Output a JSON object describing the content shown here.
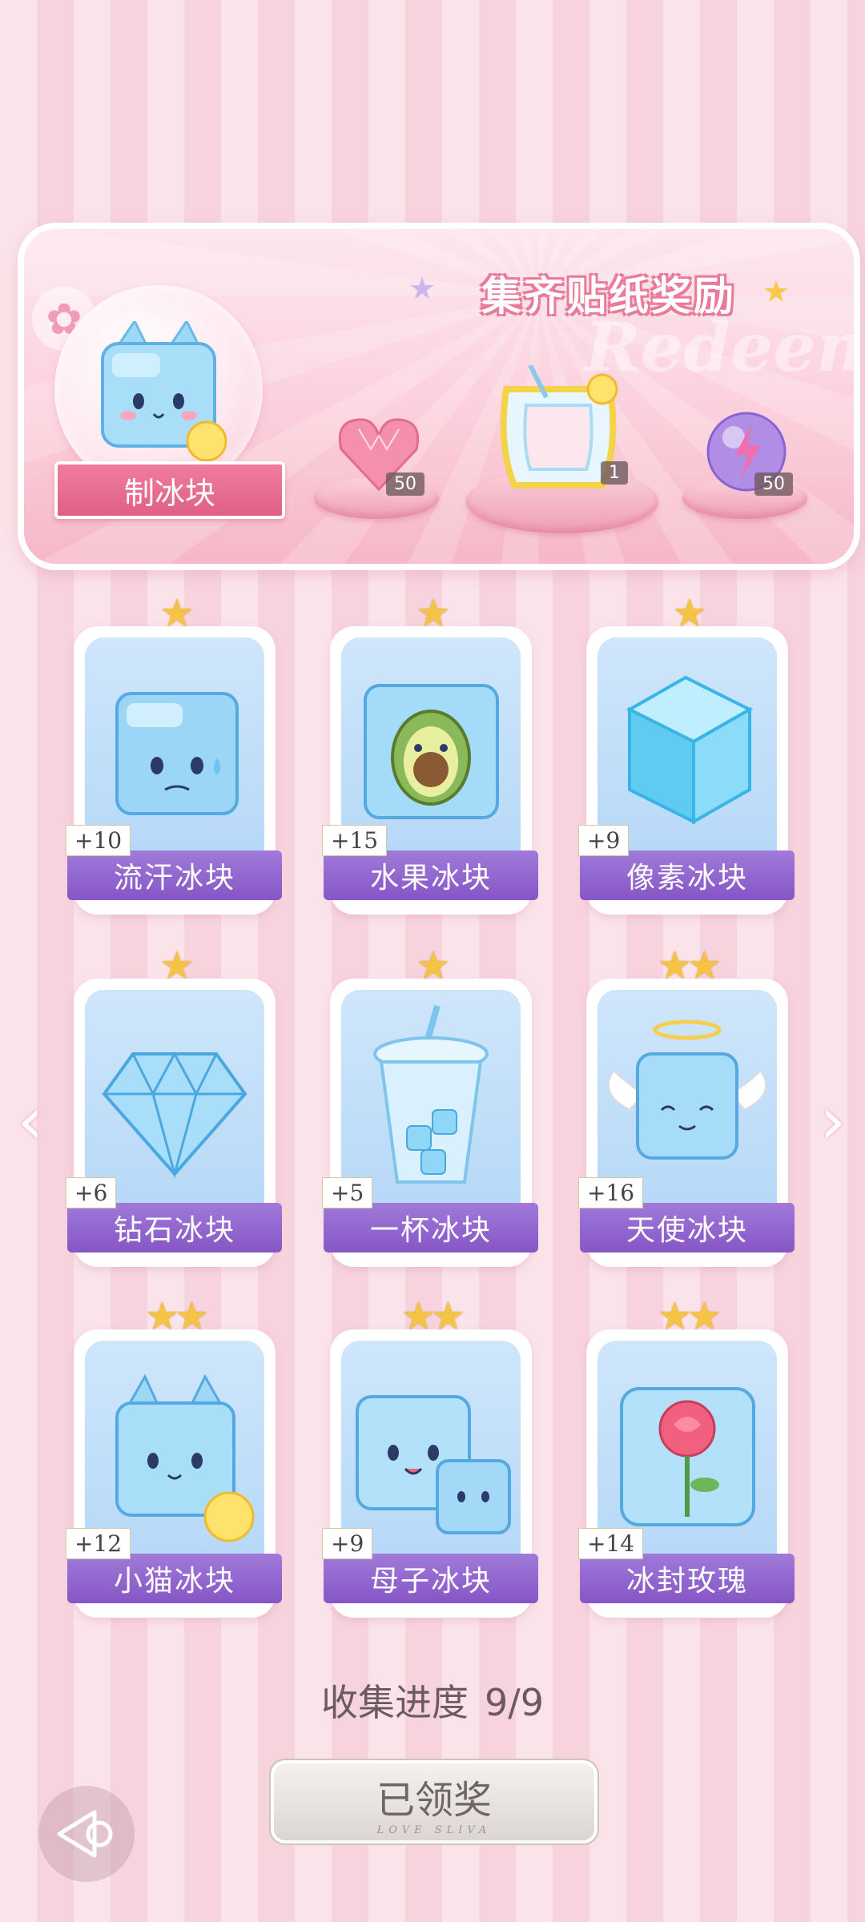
{
  "banner": {
    "title": "集齐贴纸奖励",
    "watermark": "Redeem",
    "feature_label": "制冰块",
    "rewards": [
      {
        "icon": "heart-gem-icon",
        "count": "50"
      },
      {
        "icon": "lemon-drink-frame-icon",
        "count": "1"
      },
      {
        "icon": "lightning-orb-icon",
        "count": "50"
      }
    ]
  },
  "cards": [
    {
      "name": "流汗冰块",
      "bonus": "+10",
      "stars": "★",
      "icon": "sweating-ice-cube-icon"
    },
    {
      "name": "水果冰块",
      "bonus": "+15",
      "stars": "★",
      "icon": "avocado-ice-cube-icon"
    },
    {
      "name": "像素冰块",
      "bonus": "+9",
      "stars": "★",
      "icon": "pixel-ice-cube-icon"
    },
    {
      "name": "钻石冰块",
      "bonus": "+6",
      "stars": "★",
      "icon": "diamond-ice-icon"
    },
    {
      "name": "一杯冰块",
      "bonus": "+5",
      "stars": "★",
      "icon": "cup-of-ice-icon"
    },
    {
      "name": "天使冰块",
      "bonus": "+16",
      "stars": "★★",
      "icon": "angel-ice-cube-icon"
    },
    {
      "name": "小猫冰块",
      "bonus": "+12",
      "stars": "★★",
      "icon": "cat-ice-cube-icon"
    },
    {
      "name": "母子冰块",
      "bonus": "+9",
      "stars": "★★",
      "icon": "mother-child-ice-icon"
    },
    {
      "name": "冰封玫瑰",
      "bonus": "+14",
      "stars": "★★",
      "icon": "frozen-rose-icon"
    }
  ],
  "progress": {
    "label": "收集进度",
    "value": "9/9"
  },
  "claim_button": {
    "label": "已领奖",
    "subtitle": "LOVE SLIVA"
  },
  "colors": {
    "accent": "#8656c6",
    "banner_pink": "#f07ca0",
    "star": "#f6c445"
  }
}
